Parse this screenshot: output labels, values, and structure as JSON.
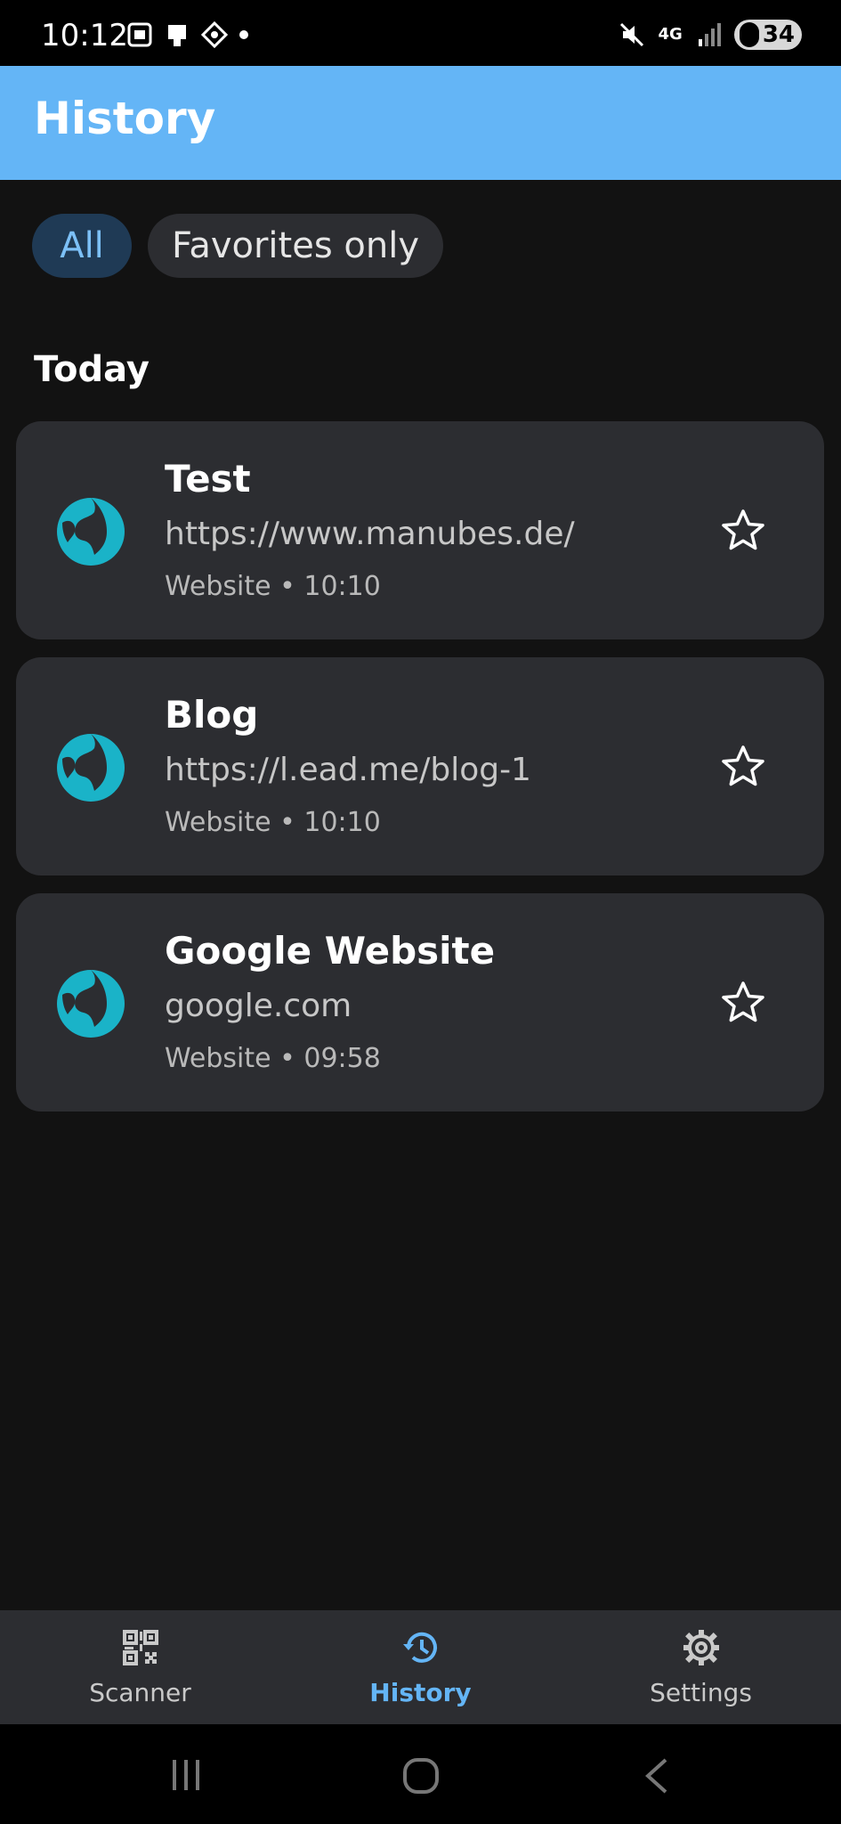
{
  "status": {
    "time": "10:12",
    "battery": "34",
    "network": "4G"
  },
  "appbar": {
    "title": "History"
  },
  "filters": [
    {
      "label": "All",
      "active": true
    },
    {
      "label": "Favorites only",
      "active": false
    }
  ],
  "section": {
    "title": "Today"
  },
  "items": [
    {
      "title": "Test",
      "url": "https://www.manubes.de/",
      "meta": "Website • 10:10",
      "icon": "globe-icon"
    },
    {
      "title": "Blog",
      "url": "https://l.ead.me/blog-1",
      "meta": "Website • 10:10",
      "icon": "globe-icon"
    },
    {
      "title": "Google Website",
      "url": "google.com",
      "meta": "Website • 09:58",
      "icon": "globe-icon"
    }
  ],
  "nav": [
    {
      "label": "Scanner",
      "icon": "qr-code-icon",
      "active": false
    },
    {
      "label": "History",
      "icon": "history-icon",
      "active": true
    },
    {
      "label": "Settings",
      "icon": "gear-icon",
      "active": false
    }
  ],
  "colors": {
    "primary": "#64b5f6",
    "background": "#121212",
    "card": "#2c2d31",
    "globe": "#1ab3c8"
  }
}
